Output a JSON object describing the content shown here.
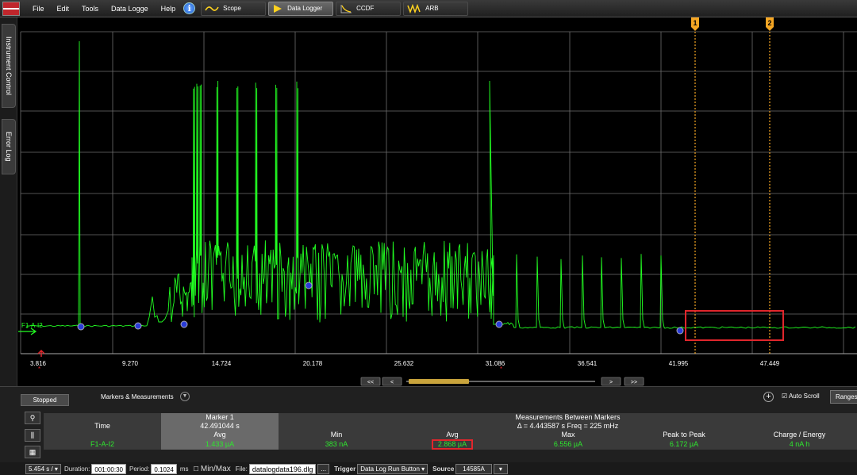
{
  "menu": {
    "file": "File",
    "edit": "Edit",
    "tools": "Tools",
    "data_logger": "Data Logge",
    "help": "Help",
    "info": "i"
  },
  "tabs": {
    "scope": "Scope",
    "data_logger": "Data Logger",
    "ccdf": "CCDF",
    "arb": "ARB"
  },
  "side_tabs": {
    "instrument_control": "Instrument Control",
    "error_log": "Error Log"
  },
  "plot": {
    "trace_label": "F1-A-I2",
    "x_ticks": [
      "3.816",
      "9.270",
      "14.724",
      "20.178",
      "25.632",
      "31.086",
      "36.541",
      "41.995",
      "47.449"
    ],
    "marker_1": "1",
    "marker_2": "2",
    "nav": {
      "first": "<<",
      "prev": "<",
      "next": ">",
      "last": ">>"
    },
    "colors": {
      "background": "#000000",
      "grid": "#6e6e6e",
      "trace": "#22ff22",
      "marker": "#f5a623",
      "highlight": "#e0262c",
      "node": "#2a3cd8"
    }
  },
  "bottom": {
    "status": "Stopped",
    "markers_measurements": "Markers & Measurements",
    "auto_scroll": "Auto Scroll",
    "ranges": "Ranges",
    "table": {
      "marker1_header": "Marker 1",
      "between_header": "Measurements Between Markers",
      "time_label": "Time",
      "marker1_time": "42.491044 s",
      "delta_freq": "Δ = 4.443587 s   Freq = 225 mHz",
      "col_avg_m1": "Avg",
      "col_min": "Min",
      "col_avg": "Avg",
      "col_max": "Max",
      "col_p2p": "Peak to Peak",
      "col_charge": "Charge / Energy",
      "channel": "F1-A-I2",
      "m1_avg": "1.433 µA",
      "min": "383 nA",
      "avg": "2.868 µA",
      "max": "6.556 µA",
      "p2p": "6.172 µA",
      "charge": "4 nA h"
    }
  },
  "footer": {
    "rate": "5.454 s / ▾",
    "duration_label": "Duration:",
    "duration": "001:00:30",
    "period_label": "Period:",
    "period": "0.1024",
    "period_unit": "ms",
    "minmax": "Min/Max",
    "file_label": "File:",
    "file": "datalogdata196.dlg",
    "browse": "...",
    "trigger_label": "Trigger",
    "trigger": "Data Log Run Button ▾",
    "source_label": "Source",
    "source": "14585A",
    "source_menu": "▾"
  }
}
